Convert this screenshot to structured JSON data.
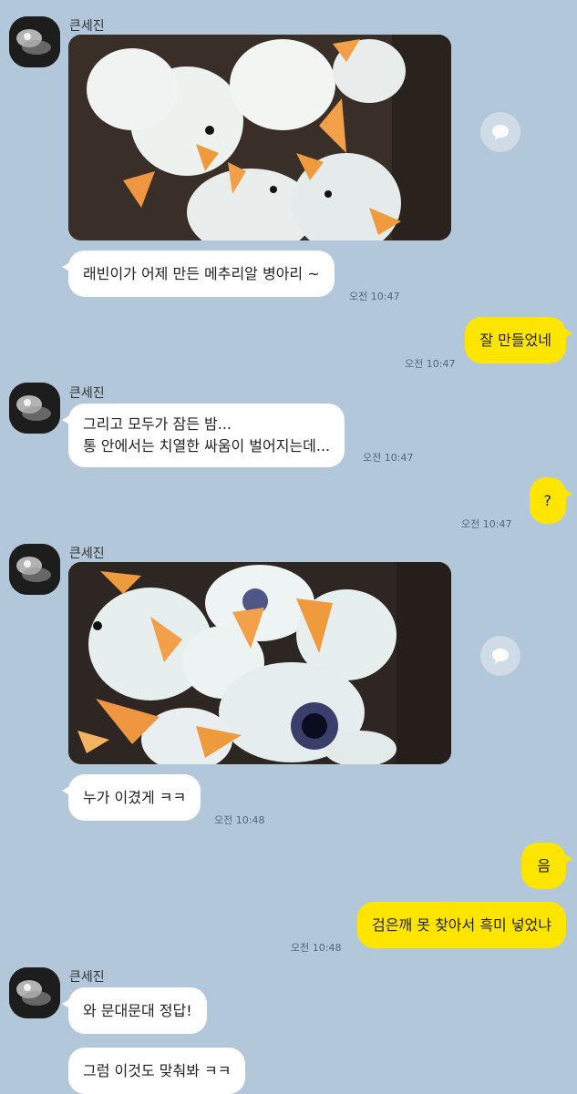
{
  "sender": {
    "name": "큰세진"
  },
  "messages": {
    "m1_text": "래빈이가 어제 만든 메추리알 병아리 ~",
    "m1_time": "오전 10:47",
    "m2_text": "잘 만들었네",
    "m2_time": "오전 10:47",
    "m3_line1": "그리고 모두가 잠든 밤...",
    "m3_line2": "통 안에서는 치열한 싸움이 벌어지는데...",
    "m3_time": "오전 10:47",
    "m4_text": "?",
    "m4_time": "오전 10:47",
    "m5_text": "누가 이겼게 ㅋㅋ",
    "m5_time": "오전 10:48",
    "m6_text": "음",
    "m7_text": "검은깨 못 찾아서 흑미 넣었냐",
    "m7_time": "오전 10:48",
    "m8_text": "와 문대문대 정답!",
    "m9_text": "그럼 이것도 맞춰봐 ㅋㅋ"
  },
  "colors": {
    "background": "#b2c7d9",
    "mine_bubble": "#fee500",
    "their_bubble": "#ffffff"
  },
  "icons": {
    "share": "share-bubble-icon"
  }
}
